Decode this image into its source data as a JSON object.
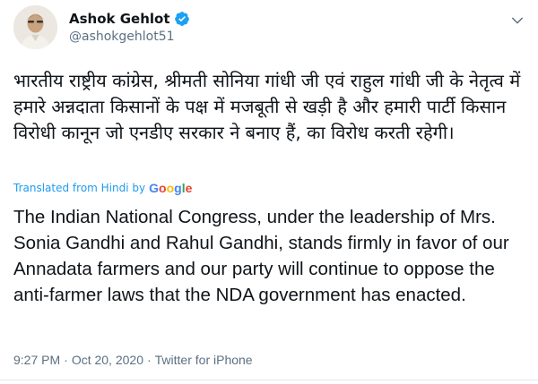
{
  "author": {
    "display_name": "Ashok Gehlot",
    "handle": "@ashokgehlot51",
    "verified": true,
    "avatar_icon": "profile-photo"
  },
  "tweet": {
    "original_text": "भारतीय राष्ट्रीय कांग्रेस, श्रीमती सोनिया गांधी जी एवं राहुल गांधी जी के नेतृत्व में हमारे अन्नदाता किसानों के पक्ष में मजबूती से खड़ी है और हमारी पार्टी किसान विरोधी कानून जो एनडीए सरकार ने बनाए हैं, का विरोध करती रहेगी।",
    "translated_label": "Translated from Hindi by",
    "translator_brand": "Google",
    "translated_text": "The Indian National Congress, under the leadership of Mrs. Sonia Gandhi and Rahul Gandhi, stands firmly in favor of our Annadata farmers and our party will continue to oppose the anti-farmer laws that the NDA government has enacted.",
    "time": "9:27 PM",
    "separator": "·",
    "date": "Oct 20, 2020",
    "source": "Twitter for iPhone"
  },
  "colors": {
    "link_blue": "#1d9bf0",
    "muted_gray": "#5b7083",
    "text": "#0f1419",
    "verified_blue": "#1da1f2"
  }
}
